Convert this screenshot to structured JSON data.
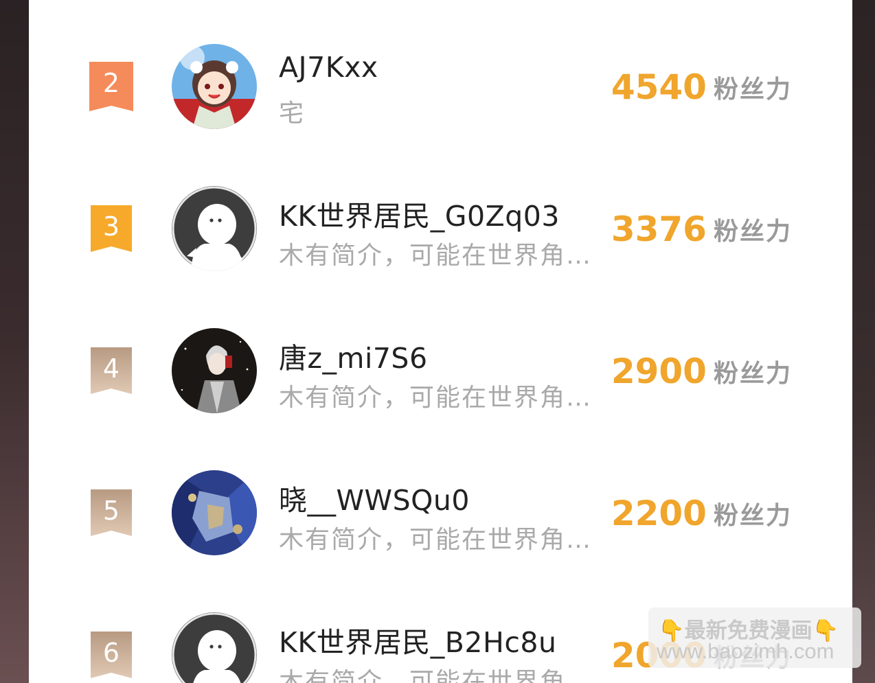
{
  "fans_unit": "粉丝力",
  "rows": [
    {
      "rank": "2",
      "name": "AJ7Kxx",
      "bio": "宅",
      "fans": "4540",
      "rank_color": "#f58b5a",
      "avatar": "anime-girl"
    },
    {
      "rank": "3",
      "name": "KK世界居民_G0Zq03",
      "bio": "木有简介，可能在世界角…",
      "fans": "3376",
      "rank_color": "#f7a92b",
      "avatar": "default"
    },
    {
      "rank": "4",
      "name": "唐z_mi7S6",
      "bio": "木有简介，可能在世界角…",
      "fans": "2900",
      "rank_color": "#c8a98e",
      "avatar": "dark-anime"
    },
    {
      "rank": "5",
      "name": "晓__WWSQu0",
      "bio": "木有简介，可能在世界角…",
      "fans": "2200",
      "rank_color": "#c8a98e",
      "avatar": "blue-mecha"
    },
    {
      "rank": "6",
      "name": "KK世界居民_B2Hc8u",
      "bio": "木有简介，可能在世界角…",
      "fans": "2000",
      "rank_color": "#c8a98e",
      "avatar": "default"
    }
  ],
  "watermark": {
    "line1": "最新免费漫画",
    "line2": "www.baozimh.com",
    "hand": "👇"
  }
}
